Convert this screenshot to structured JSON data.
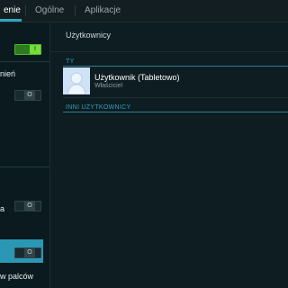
{
  "tabs": [
    {
      "label": "enie",
      "active": true
    },
    {
      "label": "Ogólne",
      "active": false
    },
    {
      "label": "Aplikacje",
      "active": false
    }
  ],
  "sidebar": {
    "labels": {
      "nien": "nień",
      "a": "a",
      "palcow": "w palców"
    },
    "toggles": {
      "top": {
        "state": "on",
        "glyph": "I"
      },
      "nien": {
        "state": "off",
        "glyph": "O"
      },
      "a": {
        "state": "off",
        "glyph": "O"
      },
      "bottom": {
        "state": "off",
        "glyph": "O"
      }
    }
  },
  "content": {
    "title": "Użytkownicy",
    "sections": {
      "you": "TY",
      "others": "INNI UŻYTKOWNICY"
    },
    "user": {
      "name": "Użytkownik (Tabletowo)",
      "role": "Właściciel",
      "avatar_icon": "user-avatar-icon"
    }
  },
  "colors": {
    "accent": "#2ea8c1",
    "toggle_on": "#74dd3b",
    "selected_row": "#2a98b4",
    "background": "#0d1d22"
  }
}
